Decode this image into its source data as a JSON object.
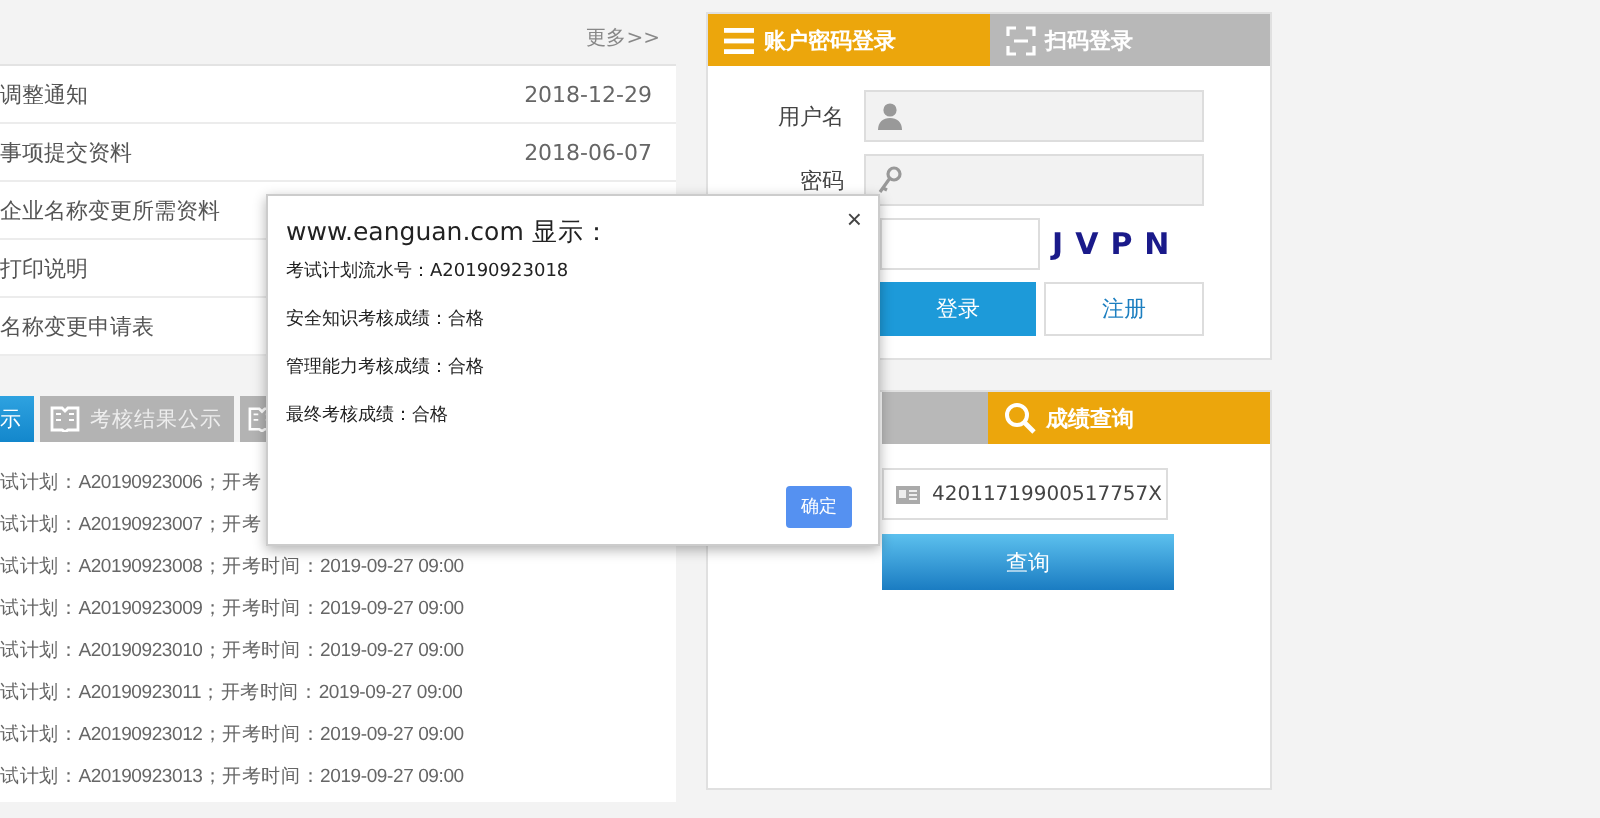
{
  "news": {
    "more": "更多>>",
    "items": [
      {
        "title": "调整通知",
        "date": "2018-12-29"
      },
      {
        "title": "事项提交资料",
        "date": "2018-06-07"
      },
      {
        "title": "企业名称变更所需资料"
      },
      {
        "title": "打印说明"
      },
      {
        "title": "名称变更申请表"
      }
    ]
  },
  "exam_tabs": [
    {
      "label": "示",
      "selected": true
    },
    {
      "label": "考核结果公示",
      "selected": false
    },
    {
      "selected": false
    }
  ],
  "exam_list": [
    "试计划：A20190923006；开考",
    "试计划：A20190923007；开考",
    "试计划：A20190923008；开考时间：2019-09-27 09:00",
    "试计划：A20190923009；开考时间：2019-09-27 09:00",
    "试计划：A20190923010；开考时间：2019-09-27 09:00",
    "试计划：A20190923011；开考时间：2019-09-27 09:00",
    "试计划：A20190923012；开考时间：2019-09-27 09:00",
    "试计划：A20190923013；开考时间：2019-09-27 09:00"
  ],
  "login": {
    "tabs": [
      {
        "label": "账户密码登录",
        "kind": "menu",
        "selected": true
      },
      {
        "label": "扫码登录",
        "kind": "scan",
        "selected": false
      }
    ],
    "username_label": "用户名",
    "password_label": "密码",
    "captcha": "JVPN",
    "login_button": "登录",
    "register_button": "注册"
  },
  "query": {
    "tabs": [
      {
        "selected": false
      },
      {
        "label": "成绩查询",
        "kind": "search",
        "selected": true
      }
    ],
    "id_value": "42011719900517757X",
    "button": "查询"
  },
  "dialog": {
    "title": "www.eanguan.com 显示：",
    "close": "×",
    "lines": [
      "考试计划流水号：A20190923018",
      "安全知识考核成绩：合格",
      "管理能力考核成绩：合格",
      "最终考核成绩：合格"
    ],
    "ok": "确定"
  }
}
